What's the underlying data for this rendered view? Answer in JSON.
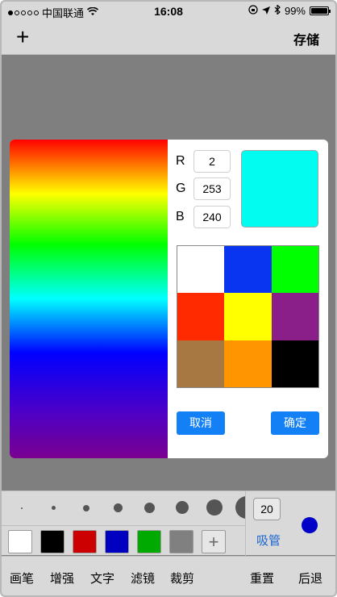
{
  "status_bar": {
    "carrier": "中国联通",
    "time": "16:08",
    "battery": "99%",
    "battery_level": 0.99
  },
  "navbar": {
    "add_label": "+",
    "save_label": "存储"
  },
  "color_dialog": {
    "r_label": "R",
    "g_label": "G",
    "b_label": "B",
    "r_value": "2",
    "g_value": "253",
    "b_value": "240",
    "preview_color": "#02fdf0",
    "palette": [
      "#ffffff",
      "#0a35f0",
      "#00ff00",
      "#ff2a00",
      "#ffff00",
      "#8b1f8a",
      "#a87843",
      "#ff9500",
      "#000000"
    ],
    "cancel_label": "取消",
    "confirm_label": "确定"
  },
  "toolbar": {
    "brush_colors": [
      "#ffffff",
      "#000000",
      "#cc0000",
      "#0000c0",
      "#00aa00",
      "#808080"
    ],
    "add_color_label": "+",
    "brush_size": "20",
    "picker_label": "吸管",
    "current_color": "#0000c8"
  },
  "tabs": [
    "画笔",
    "增强",
    "文字",
    "滤镜",
    "裁剪",
    "重置",
    "后退"
  ]
}
